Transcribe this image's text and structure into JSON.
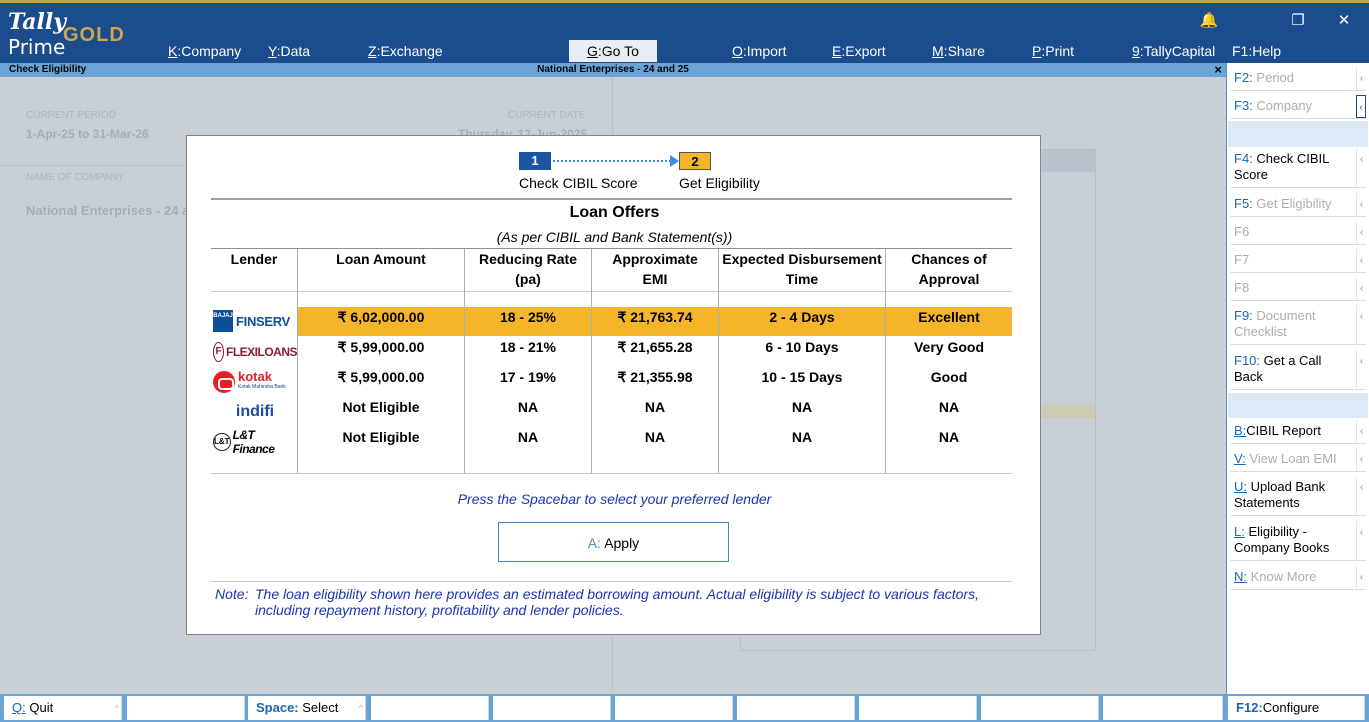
{
  "app": {
    "logo_top": "Tally",
    "logo_bottom": "Prime",
    "edition": "GOLD"
  },
  "menu": [
    {
      "key": "K",
      "label": "Company"
    },
    {
      "key": "Y",
      "label": "Data"
    },
    {
      "key": "Z",
      "label": "Exchange"
    },
    {
      "key": "G",
      "label": "Go To"
    },
    {
      "key": "O",
      "label": "Import"
    },
    {
      "key": "E",
      "label": "Export"
    },
    {
      "key": "M",
      "label": "Share"
    },
    {
      "key": "P",
      "label": "Print"
    },
    {
      "key": "9",
      "label": "TallyCapital"
    },
    {
      "key": "F1",
      "label": "Help"
    }
  ],
  "window_controls": {
    "bell": "🔔",
    "restore": "❐",
    "close": "✕"
  },
  "subbar": {
    "title": "Check Eligibility",
    "company": "National Enterprises - 24 and 25",
    "close": "×"
  },
  "background": {
    "period_label": "CURRENT PERIOD",
    "period_value": "1-Apr-25 to 31-Mar-26",
    "date_label": "CURRENT DATE",
    "date_value": "Thursday, 12-Jun-2025",
    "company_label": "NAME OF COMPANY",
    "company_value": "National Enterprises - 24 a"
  },
  "steps": {
    "one": "1",
    "two": "2",
    "one_label": "Check CIBIL Score",
    "two_label": "Get Eligibility"
  },
  "offers": {
    "title": "Loan Offers",
    "subtitle": "(As per CIBIL and Bank Statement(s))",
    "headers": {
      "lender": "Lender",
      "amount": "Loan Amount",
      "rate_1": "Reducing Rate",
      "rate_2": "(pa)",
      "emi_1": "Approximate",
      "emi_2": "EMI",
      "time_1": "Expected Disbursement",
      "time_2": "Time",
      "chance_1": "Chances of",
      "chance_2": "Approval"
    },
    "rows": [
      {
        "lender": "Bajaj Finserv",
        "logo_a": "BAJAJ",
        "logo_b": "FINSERV",
        "amount": "₹ 6,02,000.00",
        "rate": "18 - 25%",
        "emi": "₹ 21,763.74",
        "time": "2 - 4 Days",
        "chance": "Excellent"
      },
      {
        "lender": "FlexiLoans",
        "logo_a": "F",
        "logo_b": "FLEXILOANS",
        "amount": "₹ 5,99,000.00",
        "rate": "18 - 21%",
        "emi": "₹ 21,655.28",
        "time": "6 - 10 Days",
        "chance": "Very Good"
      },
      {
        "lender": "Kotak",
        "logo_a": "kotak",
        "logo_b": "Kotak Mahindra Bank",
        "amount": "₹ 5,99,000.00",
        "rate": "17 - 19%",
        "emi": "₹ 21,355.98",
        "time": "10 - 15 Days",
        "chance": "Good"
      },
      {
        "lender": "indifi",
        "logo_a": "indifi",
        "logo_b": "",
        "amount": "Not Eligible",
        "rate": "NA",
        "emi": "NA",
        "time": "NA",
        "chance": "NA"
      },
      {
        "lender": "L&T Finance",
        "logo_a": "L&T",
        "logo_b": "L&T Finance",
        "amount": "Not Eligible",
        "rate": "NA",
        "emi": "NA",
        "time": "NA",
        "chance": "NA"
      }
    ],
    "prompt": "Press the Spacebar to select your preferred lender",
    "apply_key": "A:",
    "apply_label": "Apply",
    "note_label": "Note:",
    "note_text": "The loan eligibility shown here provides an estimated borrowing amount. Actual eligibility is subject to various factors, including repayment history, profitability and lender policies."
  },
  "sidebar": [
    {
      "key": "F2:",
      "label": "Period",
      "enabled": false
    },
    {
      "key": "F3:",
      "label": "Company",
      "enabled": false
    },
    {
      "key": "F4:",
      "label": "Check CIBIL Score",
      "enabled": true
    },
    {
      "key": "F5:",
      "label": "Get Eligibility",
      "enabled": false
    },
    {
      "key": "F6",
      "label": "",
      "enabled": false
    },
    {
      "key": "F7",
      "label": "",
      "enabled": false
    },
    {
      "key": "F8",
      "label": "",
      "enabled": false
    },
    {
      "key": "F9:",
      "label": "Document Checklist",
      "enabled": false
    },
    {
      "key": "F10:",
      "label": "Get a Call Back",
      "enabled": true
    },
    {
      "key": "B:",
      "label": "CIBIL Report",
      "enabled": true
    },
    {
      "key": "V:",
      "label": "View Loan EMI",
      "enabled": false
    },
    {
      "key": "U:",
      "label": "Upload Bank Statements",
      "enabled": true
    },
    {
      "key": "L:",
      "label": "Eligibility - Company Books",
      "enabled": true
    },
    {
      "key": "N:",
      "label": "Know More",
      "enabled": false
    }
  ],
  "bottom": {
    "quit_key": "Q:",
    "quit_label": "Quit",
    "select_key": "Space:",
    "select_label": "Select",
    "configure_key": "F12:",
    "configure_label": "Configure"
  }
}
